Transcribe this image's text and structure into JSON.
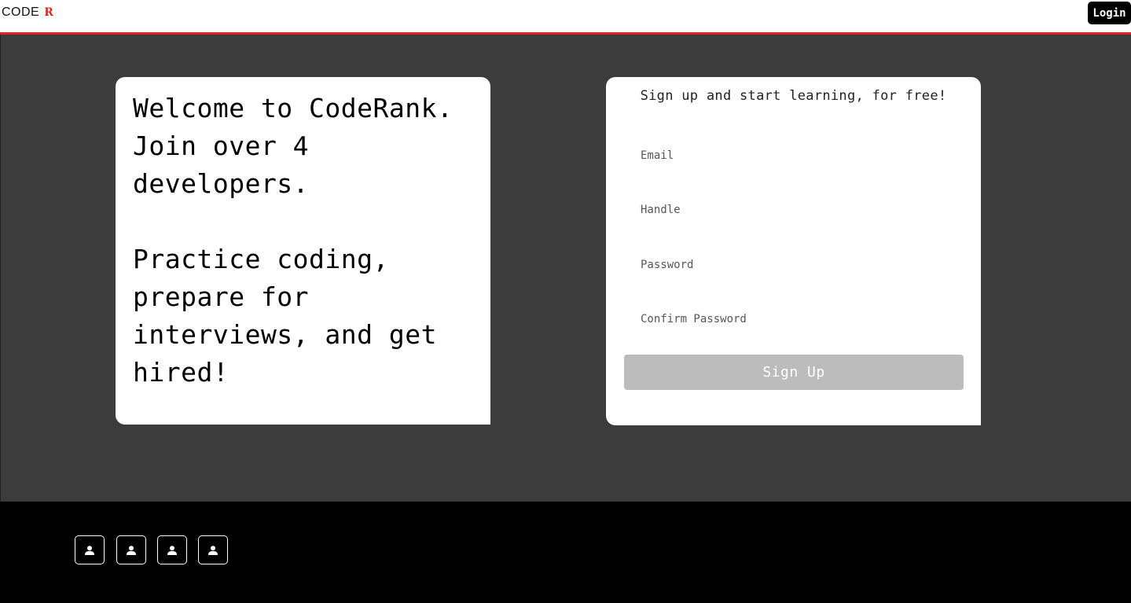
{
  "header": {
    "logo_text": "CODE",
    "logo_mark": "R",
    "login_label": "Login"
  },
  "welcome": {
    "line1": "Welcome to CodeRank. Join over 4 developers.",
    "line2": "Practice coding, prepare for interviews, and get hired!"
  },
  "signup": {
    "title": "Sign up and start learning, for free!",
    "email_placeholder": "Email",
    "handle_placeholder": "Handle",
    "password_placeholder": "Password",
    "confirm_placeholder": "Confirm Password",
    "button_label": "Sign Up"
  },
  "footer": {
    "icons": [
      "user-icon",
      "user-icon",
      "user-icon",
      "user-icon"
    ]
  },
  "colors": {
    "accent": "#e02424",
    "background": "#3c3c3c",
    "button_disabled": "#bcbcbc"
  }
}
